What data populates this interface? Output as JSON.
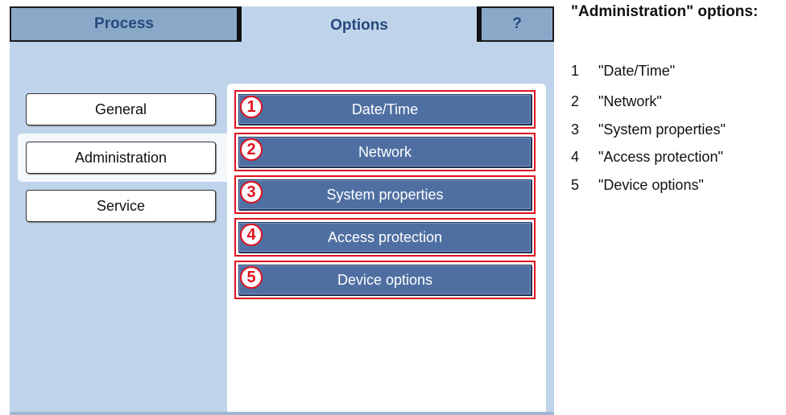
{
  "tabs": {
    "process": "Process",
    "options": "Options",
    "help": "?"
  },
  "sidebar": {
    "items": [
      {
        "label": "General"
      },
      {
        "label": "Administration",
        "selected": true
      },
      {
        "label": "Service"
      }
    ]
  },
  "menu": {
    "items": [
      {
        "number": "1",
        "label": "Date/Time"
      },
      {
        "number": "2",
        "label": "Network"
      },
      {
        "number": "3",
        "label": "System properties"
      },
      {
        "number": "4",
        "label": "Access protection"
      },
      {
        "number": "5",
        "label": "Device options"
      }
    ]
  },
  "legend": {
    "title": "\"Administration\" options:",
    "items": [
      {
        "number": "1",
        "label": "\"Date/Time\""
      },
      {
        "number": "2",
        "label": "\"Network\""
      },
      {
        "number": "3",
        "label": "\"System properties\""
      },
      {
        "number": "4",
        "label": "\"Access protection\""
      },
      {
        "number": "5",
        "label": "\"Device options\""
      }
    ]
  },
  "colors": {
    "panel": "#bfd4ea",
    "tab_inactive": "#8aa9c9",
    "tab_text": "#26487c",
    "menu_button": "#4f6fa2",
    "callout_red": "#e0121e"
  }
}
